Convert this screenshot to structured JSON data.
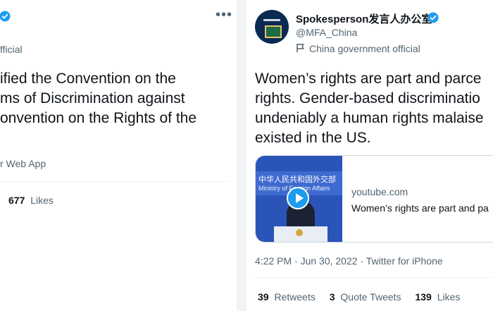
{
  "left_tweet": {
    "official_label": "fficial",
    "text": "ified the Convention on the\nms of Discrimination against\nonvention on the Rights of the",
    "source": "r Web App",
    "likes_count": "677",
    "likes_label": "Likes"
  },
  "right_tweet": {
    "display_name": "Spokesperson发言人办公室",
    "handle": "@MFA_China",
    "account_label": "China government official",
    "text": "Women’s rights are part and parce\nrights. Gender-based discriminatio\nundeniably a human rights malaise\nexisted in the US.",
    "media": {
      "thumb_text_cn": "中华人民共和国外交部",
      "thumb_text_en": "Ministry of Foreign Affairs",
      "domain": "youtube.com",
      "title": "Women’s rights are part and pa"
    },
    "time": "4:22 PM · Jun 30, 2022",
    "client": "Twitter for iPhone",
    "stats": {
      "retweets_count": "39",
      "retweets_label": "Retweets",
      "quotes_count": "3",
      "quotes_label": "Quote Tweets",
      "likes_count": "139",
      "likes_label": "Likes"
    }
  },
  "colors": {
    "verified_blue": "#1d9bf0",
    "secondary_text": "#536471",
    "border": "#cfd9de"
  },
  "icons": [
    "verified-badge-icon",
    "more-options-icon",
    "flag-icon",
    "play-icon"
  ]
}
